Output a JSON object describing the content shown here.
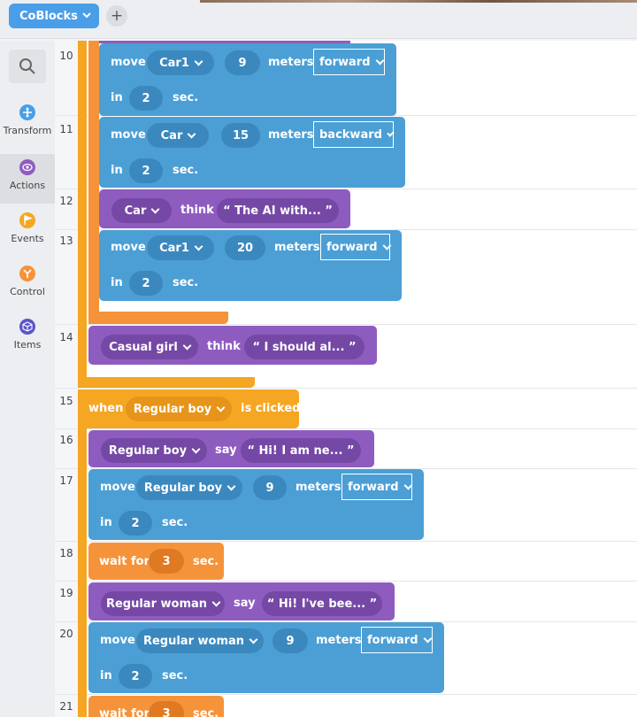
{
  "app": {
    "name": "CoBlocks",
    "add_label": "+"
  },
  "sidebar": {
    "categories": [
      {
        "label": "Transform",
        "icon": "transform-icon",
        "color": "#4a9ee8"
      },
      {
        "label": "Actions",
        "icon": "actions-icon",
        "color": "#8e5cbf"
      },
      {
        "label": "Events",
        "icon": "events-icon",
        "color": "#f5a623"
      },
      {
        "label": "Control",
        "icon": "control-icon",
        "color": "#f5933a"
      },
      {
        "label": "Items",
        "icon": "items-icon",
        "color": "#5b54c9"
      }
    ],
    "selected": "Actions"
  },
  "lines": [
    "10",
    "11",
    "12",
    "13",
    "14",
    "15",
    "16",
    "17",
    "18",
    "19",
    "20",
    "21"
  ],
  "words": {
    "move": "move",
    "meters": "meters",
    "in": "in",
    "sec": "sec.",
    "think": "think",
    "say": "say",
    "when": "when",
    "is_clicked": "is clicked",
    "wait_for": "wait for"
  },
  "blocks": {
    "b10": {
      "target": "Car1",
      "distance": "9",
      "direction": "forward",
      "time": "2"
    },
    "b11": {
      "target": "Car",
      "distance": "15",
      "direction": "backward",
      "time": "2"
    },
    "b12": {
      "actor": "Car",
      "text": "“ The AI with... ”"
    },
    "b13": {
      "target": "Car1",
      "distance": "20",
      "direction": "forward",
      "time": "2"
    },
    "b14": {
      "actor": "Casual girl",
      "text": "“ I should al... ”"
    },
    "b15": {
      "actor": "Regular boy"
    },
    "b16": {
      "actor": "Regular boy",
      "text": "“ Hi! I am ne... ”"
    },
    "b17": {
      "target": "Regular boy",
      "distance": "9",
      "direction": "forward",
      "time": "2"
    },
    "b18": {
      "time": "3"
    },
    "b19": {
      "actor": "Regular woman",
      "text": "“ Hi! I've bee... ”"
    },
    "b20": {
      "target": "Regular woman",
      "distance": "9",
      "direction": "forward",
      "time": "2"
    },
    "b21": {
      "time": "3"
    }
  },
  "colors": {
    "move": "#4b9fd5",
    "speech": "#8e5cbf",
    "event": "#f5a623",
    "control": "#f5933a"
  }
}
